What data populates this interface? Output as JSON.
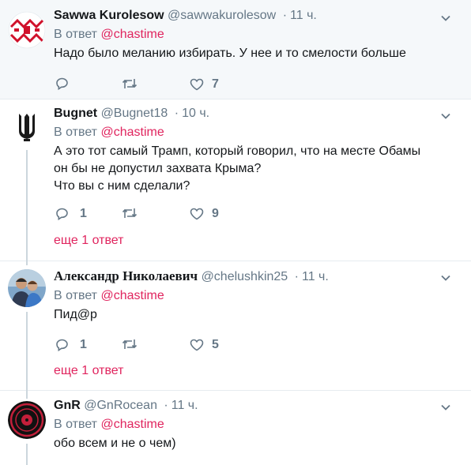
{
  "reply_prefix": "В ответ",
  "tweets": [
    {
      "name": "Sawwa Kurolesow",
      "handle": "@sawwakurolesow",
      "separator": "·",
      "time": "11 ч.",
      "reply_to": "@chastime",
      "text": "Надо было меланию избирать.  У нее и то смелости больше",
      "replies": "",
      "retweets": "",
      "likes": "7",
      "avatar_icon": "ornament-avatar"
    },
    {
      "name": "Bugnet",
      "handle": "@Bugnet18",
      "separator": "·",
      "time": "10 ч.",
      "reply_to": "@chastime",
      "text_lines": [
        "А это тот самый Трамп, который говорил, что на месте Обамы",
        "он бы не допустил захвата Крыма?",
        "Что вы с ним сделали?"
      ],
      "replies": "1",
      "retweets": "",
      "likes": "9",
      "more": "еще 1 ответ",
      "avatar_icon": "trident-avatar"
    },
    {
      "name": "Александр Николаевич",
      "handle": "@chelushkin25",
      "separator": "·",
      "time": "11 ч.",
      "reply_to": "@chastime",
      "text": "Пид@р",
      "replies": "1",
      "retweets": "",
      "likes": "5",
      "more": "еще 1 ответ",
      "avatar_icon": "photo-avatar"
    },
    {
      "name": "GnR",
      "handle": "@GnRocean",
      "separator": "·",
      "time": "11 ч.",
      "reply_to": "@chastime",
      "text": "обо всем и не о чем)",
      "avatar_icon": "gnr-logo-avatar"
    }
  ]
}
